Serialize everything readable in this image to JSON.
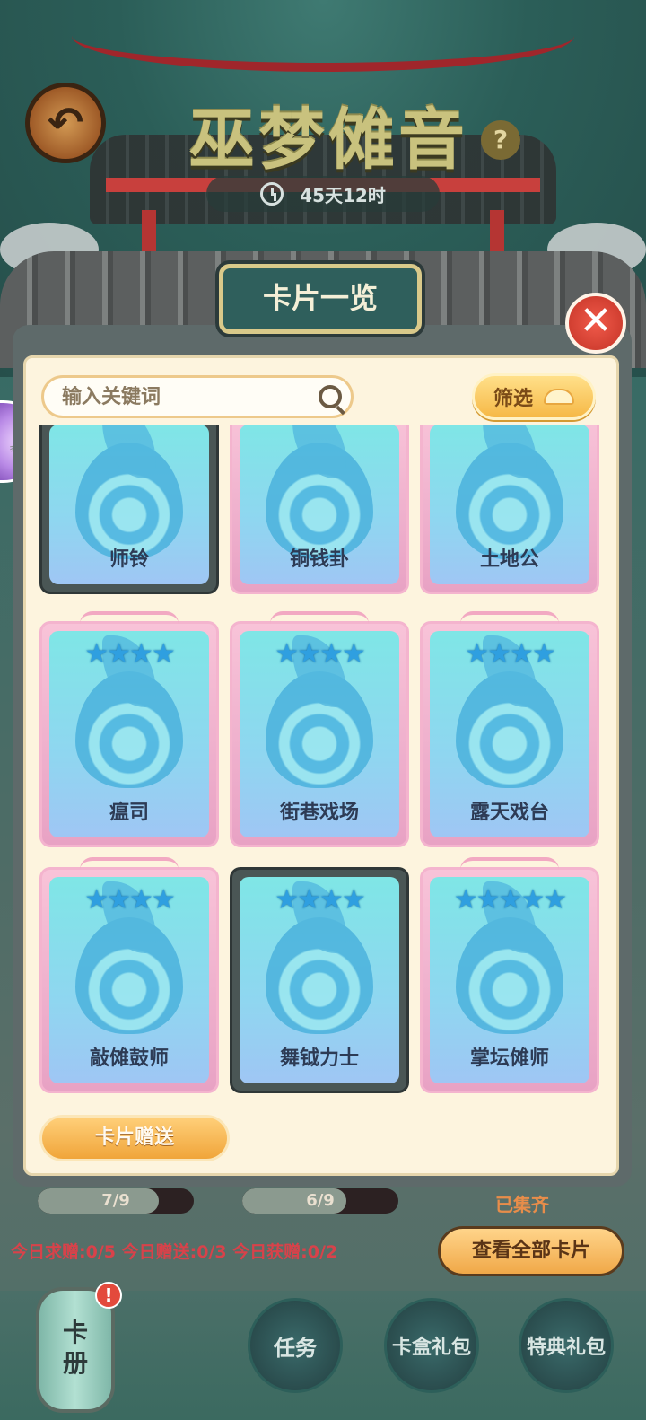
{
  "header": {
    "back_icon": "back-arrow-icon",
    "title": "巫梦傩音",
    "help": "?",
    "timer": "45天12时"
  },
  "modal": {
    "title": "卡片一览",
    "close_icon": "close-x-icon",
    "close": "✕",
    "search_placeholder": "输入关键词",
    "filter_label": "筛选"
  },
  "cards": [
    {
      "name": "师铃",
      "stars": 0,
      "frame": "dark"
    },
    {
      "name": "铜钱卦",
      "stars": 0,
      "frame": "pink"
    },
    {
      "name": "土地公",
      "stars": 0,
      "frame": "pink"
    },
    {
      "name": "瘟司",
      "stars": 4,
      "frame": "pink"
    },
    {
      "name": "街巷戏场",
      "stars": 4,
      "frame": "pink"
    },
    {
      "name": "露天戏台",
      "stars": 4,
      "frame": "pink"
    },
    {
      "name": "敲傩鼓师",
      "stars": 4,
      "frame": "pink"
    },
    {
      "name": "舞钺力士",
      "stars": 4,
      "frame": "dark"
    },
    {
      "name": "掌坛傩师",
      "stars": 5,
      "frame": "pink"
    }
  ],
  "gift_button": "卡片赠送",
  "progress": [
    {
      "label": "7/9",
      "fraction": 0.778
    },
    {
      "label": "6/9",
      "fraction": 0.667
    }
  ],
  "collected_label": "已集齐",
  "daily_stats": "今日求赠:0/5 今日赠送:0/3 今日获赠:0/2",
  "view_all_button": "查看全部卡片",
  "bottom_nav": {
    "album_label": "卡册",
    "album_badge": "!",
    "tasks": "任务",
    "card_box": "卡盒礼包",
    "special": "特典礼包"
  },
  "colors": {
    "panel_bg": "#fdf4de",
    "accent_orange": "#f0a53a",
    "alert_red": "#d8424a",
    "card_blue": "#7fe6e6"
  }
}
